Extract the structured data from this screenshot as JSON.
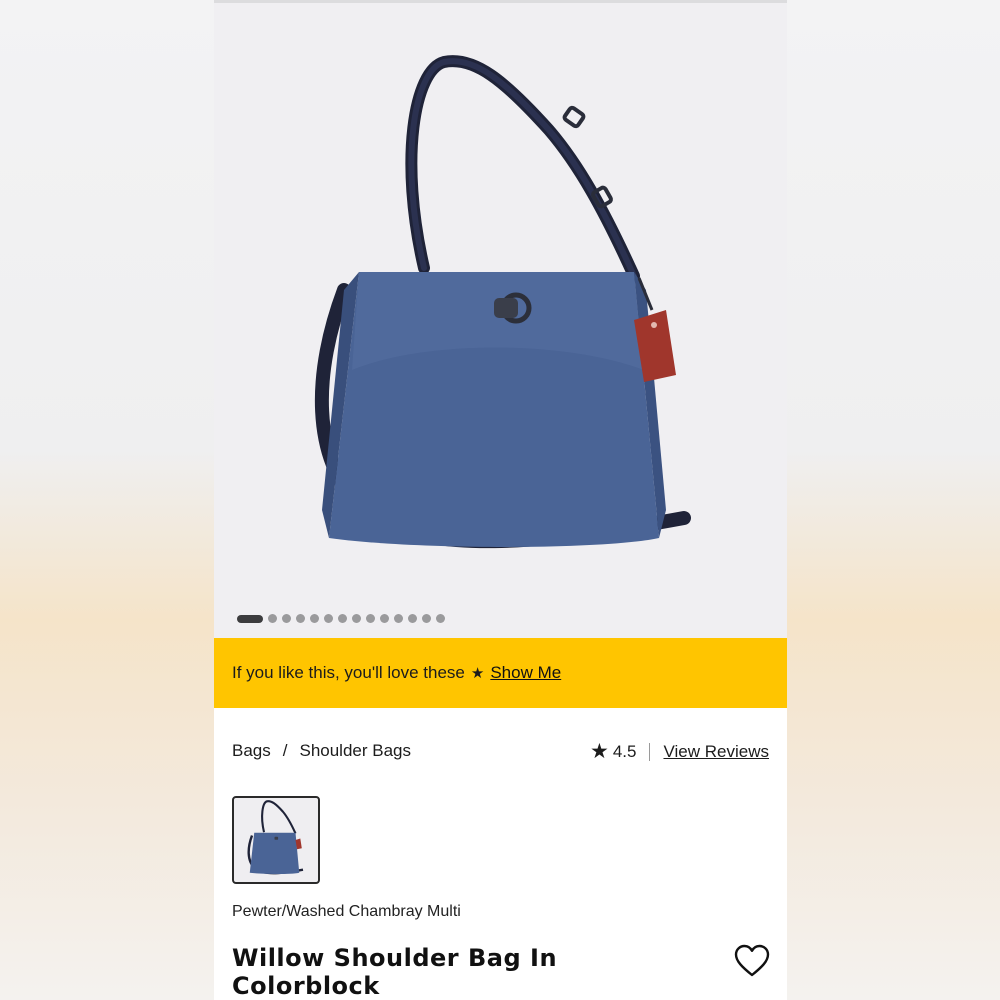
{
  "hero": {
    "image_alt": "Willow Shoulder Bag In Colorblock",
    "carousel_total": 14,
    "carousel_active_index": 0
  },
  "promo": {
    "text": "If you like this, you'll love these",
    "star": "★",
    "link_label": "Show Me",
    "background": "#ffc500"
  },
  "breadcrumb": {
    "items": [
      "Bags",
      "/",
      "Shoulder Bags"
    ]
  },
  "rating": {
    "star": "★",
    "value": "4.5",
    "reviews_label": "View Reviews"
  },
  "product": {
    "color_name": "Pewter/Washed Chambray Multi",
    "title": "Willow Shoulder Bag In Colorblock",
    "heart_icon": "heart-outline-icon",
    "bag_color": "#4a6496",
    "strap_color": "#1f2338",
    "tag_color": "#a0362c"
  }
}
